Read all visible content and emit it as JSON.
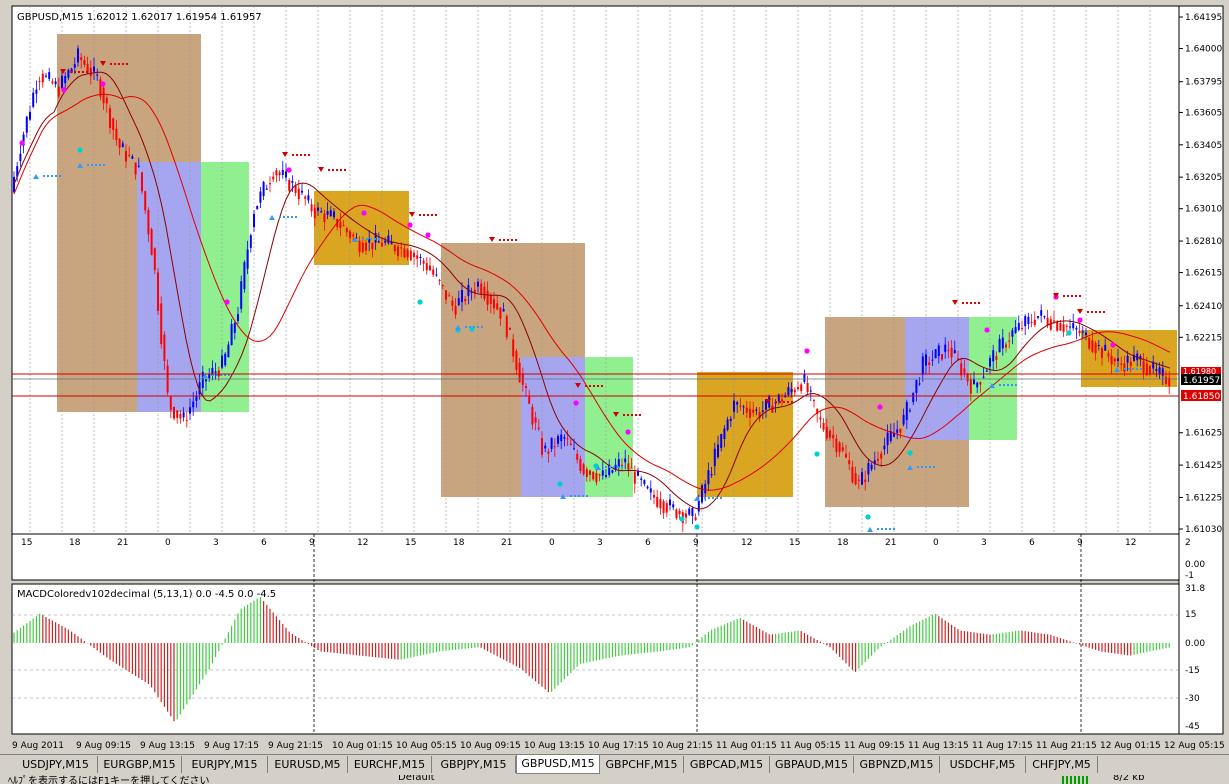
{
  "chart_header": {
    "symbol_info": "GBPUSD,M15  1.62012 1.62017 1.61954 1.61957"
  },
  "price_axis": {
    "ticks": [
      "1.64195",
      "1.64000",
      "1.63795",
      "1.63605",
      "1.63405",
      "1.63205",
      "1.63010",
      "1.62810",
      "1.62615",
      "1.62410",
      "1.62215",
      "1.61625",
      "1.61425",
      "1.61225",
      "1.61030"
    ],
    "current_price": "1.61957",
    "line_upper": "1.61980",
    "line_lower": "1.61850"
  },
  "sub_hour_axis": {
    "labels": [
      "15",
      "18",
      "21",
      "0",
      "3",
      "6",
      "9",
      "12",
      "15",
      "18",
      "21",
      "0",
      "3",
      "6",
      "9",
      "12",
      "15",
      "18",
      "21",
      "0",
      "3",
      "6",
      "9",
      "12"
    ]
  },
  "sub_axis_right": [
    "2",
    "0.00",
    "-1"
  ],
  "macd_indicator": {
    "title": "MACDColoredv102decimal (5,13,1) 0.0 -4.5 0.0 -4.5",
    "ticks": [
      "31.8",
      "15",
      "0.00",
      "-15",
      "-30",
      "-45"
    ]
  },
  "time_axis": {
    "labels": [
      "9 Aug 2011",
      "9 Aug 09:15",
      "9 Aug 13:15",
      "9 Aug 17:15",
      "9 Aug 21:15",
      "10 Aug 01:15",
      "10 Aug 05:15",
      "10 Aug 09:15",
      "10 Aug 13:15",
      "10 Aug 17:15",
      "10 Aug 21:15",
      "11 Aug 01:15",
      "11 Aug 05:15",
      "11 Aug 09:15",
      "11 Aug 13:15",
      "11 Aug 17:15",
      "11 Aug 21:15",
      "12 Aug 01:15",
      "12 Aug 05:15"
    ]
  },
  "tabs": [
    {
      "label": "USDJPY,M15",
      "active": false
    },
    {
      "label": "EURGBP,M15",
      "active": false
    },
    {
      "label": "EURJPY,M15",
      "active": false
    },
    {
      "label": "EURUSD,M5",
      "active": false
    },
    {
      "label": "EURCHF,M15",
      "active": false
    },
    {
      "label": "GBPJPY,M15",
      "active": false
    },
    {
      "label": "GBPUSD,M15",
      "active": true
    },
    {
      "label": "GBPCHF,M15",
      "active": false
    },
    {
      "label": "GBPCAD,M15",
      "active": false
    },
    {
      "label": "GBPAUD,M15",
      "active": false
    },
    {
      "label": "GBPNZD,M15",
      "active": false
    },
    {
      "label": "USDCHF,M5",
      "active": false
    },
    {
      "label": "CHFJPY,M5",
      "active": false
    }
  ],
  "status_bar": {
    "help_text": "ﾍﾙﾌﾟを表示するにはF1キーを押してください",
    "profile": "Default",
    "traffic": "8/2 kb"
  },
  "colors": {
    "bull_candle": "#0000ff",
    "bear_candle": "#ff0000",
    "box_tan": "#c8a57e",
    "box_orange": "#daa520",
    "box_purple": "#a6a6f0",
    "box_green": "#90f090",
    "macd_up": "#44cc44",
    "macd_down": "#cc2222"
  }
}
